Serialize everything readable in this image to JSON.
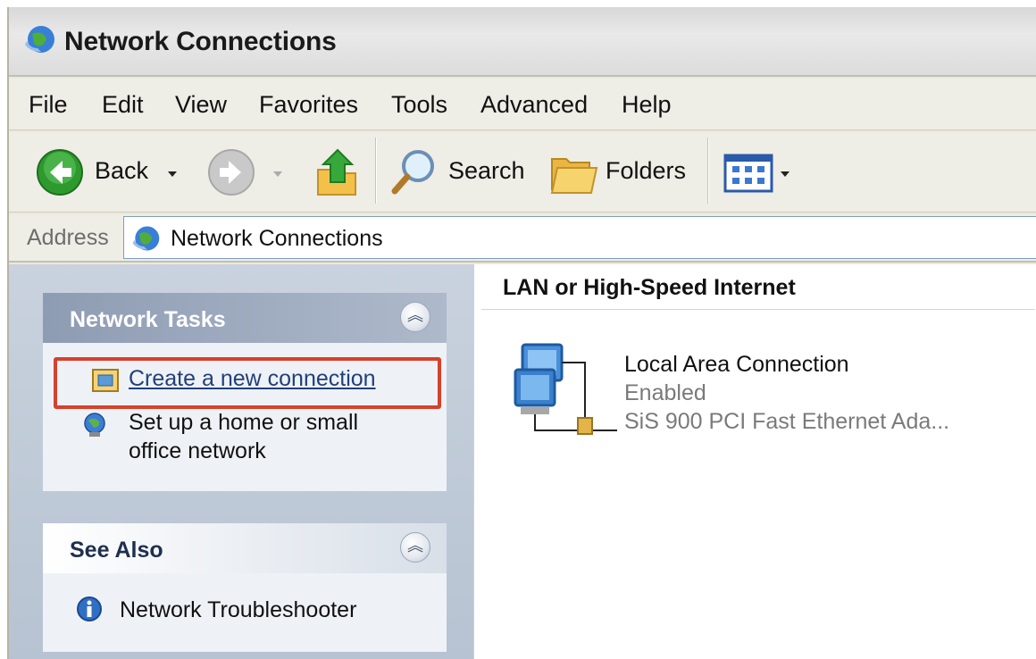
{
  "window": {
    "title": "Network Connections"
  },
  "menu": {
    "items": [
      "File",
      "Edit",
      "View",
      "Favorites",
      "Tools",
      "Advanced",
      "Help"
    ]
  },
  "toolbar": {
    "back_label": "Back",
    "search_label": "Search",
    "folders_label": "Folders"
  },
  "address": {
    "label": "Address",
    "value": "Network Connections"
  },
  "network_tasks": {
    "title": "Network Tasks",
    "items": [
      {
        "label": "Create a new connection",
        "icon": "new-connection-icon"
      },
      {
        "label_line1": "Set up a home or small",
        "label_line2": "office network",
        "icon": "home-network-icon"
      }
    ]
  },
  "see_also": {
    "title": "See Also",
    "items": [
      {
        "label": "Network Troubleshooter",
        "icon": "info-icon"
      }
    ]
  },
  "content": {
    "group_header": "LAN or High-Speed Internet",
    "connections": [
      {
        "name": "Local Area Connection",
        "status": "Enabled",
        "device": "SiS 900 PCI Fast Ethernet Ada..."
      }
    ]
  },
  "colors": {
    "highlight": "#d7402b",
    "link": "#213f7a",
    "pane_bg": "#b7c3d2"
  }
}
